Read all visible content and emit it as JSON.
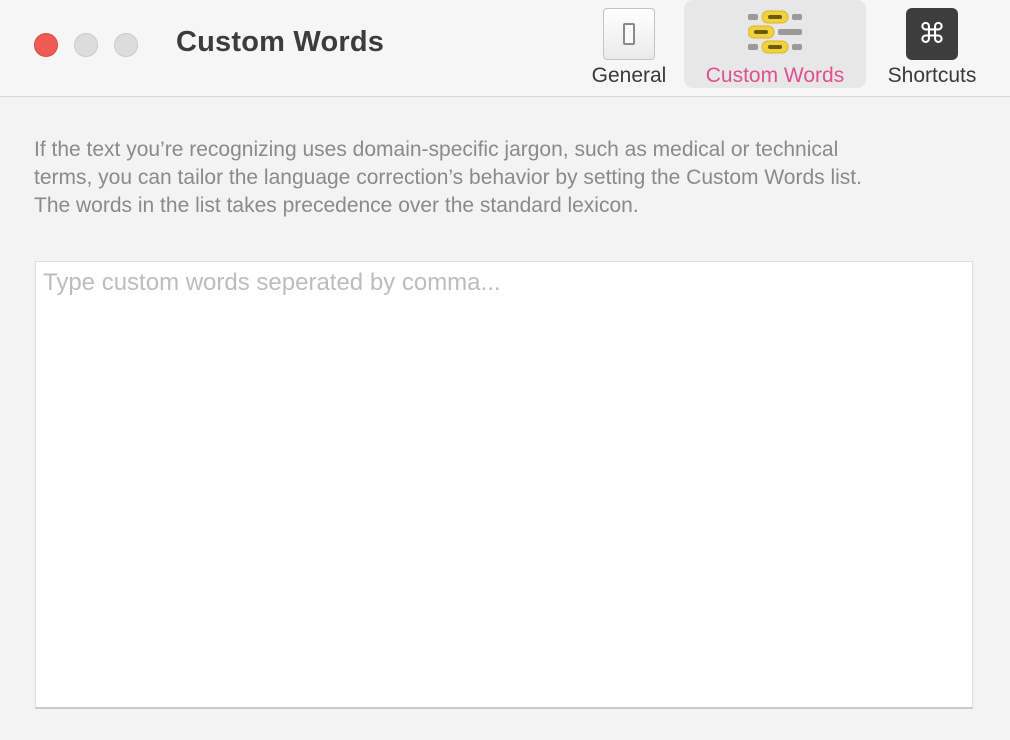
{
  "window": {
    "title": "Custom Words"
  },
  "toolbar": {
    "tabs": [
      {
        "label": "General",
        "icon": "toggle-switch-icon",
        "selected": false
      },
      {
        "label": "Custom Words",
        "icon": "custom-words-icon",
        "selected": true
      },
      {
        "label": "Shortcuts",
        "icon": "command-key-icon",
        "selected": false
      }
    ],
    "shortcuts_glyph": "⌘"
  },
  "main": {
    "description_lines": [
      "If the text you’re recognizing uses domain-specific jargon, such as medical or technical",
      "terms, you can tailor the language correction’s behavior by setting the Custom Words list.",
      "The words in the list takes precedence over the standard lexicon."
    ],
    "custom_words": {
      "value": "",
      "placeholder": "Type custom words seperated by comma..."
    }
  },
  "colors": {
    "accent": "#e0508e",
    "close_button": "#ee5b55",
    "highlight_yellow": "#f2d23c"
  }
}
